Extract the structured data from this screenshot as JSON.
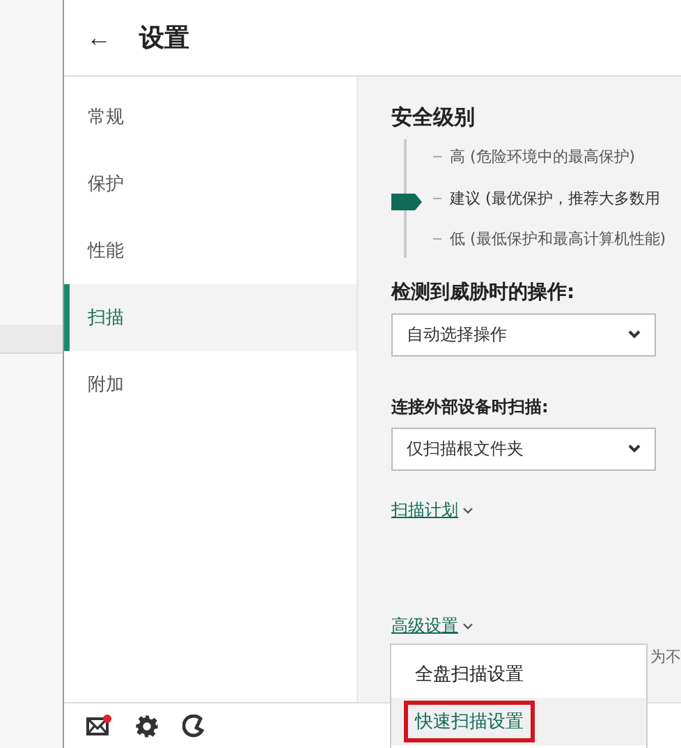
{
  "header": {
    "back_icon": "←",
    "title": "设置"
  },
  "sidebar": {
    "items": [
      {
        "label": "常规",
        "selected": false
      },
      {
        "label": "保护",
        "selected": false
      },
      {
        "label": "性能",
        "selected": false
      },
      {
        "label": "扫描",
        "selected": true
      },
      {
        "label": "附加",
        "selected": false
      }
    ]
  },
  "security_level": {
    "title": "安全级别",
    "levels": [
      {
        "name": "高",
        "description": "(危险环境中的最高保护)",
        "selected": false
      },
      {
        "name": "建议",
        "description": "(最优保护，推荐大多数用",
        "selected": true
      },
      {
        "name": "低",
        "description": "(最低保护和最高计算机性能)",
        "selected": false
      }
    ]
  },
  "threat_action": {
    "label": "检测到威胁时的操作:",
    "value": "自动选择操作"
  },
  "external_device_scan": {
    "label": "连接外部设备时扫描:",
    "value": "仅扫描根文件夹"
  },
  "scan_schedule_link": "扫描计划",
  "advanced_settings_link": "高级设置",
  "covered_text": "为不",
  "advanced_menu": {
    "items": [
      {
        "label": "全盘扫描设置",
        "highlighted": false
      },
      {
        "label": "快速扫描设置",
        "highlighted": true
      }
    ]
  },
  "footer": {
    "mail_unread": true
  }
}
